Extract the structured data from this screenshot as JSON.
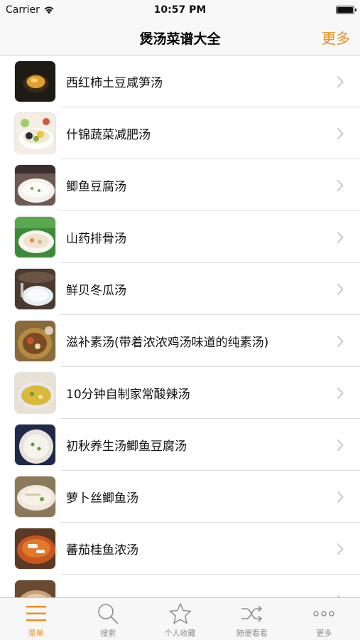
{
  "status_bar": {
    "carrier": "Carrier",
    "time": "10:57 PM"
  },
  "nav": {
    "title": "煲汤菜谱大全",
    "more": "更多"
  },
  "recipes": [
    {
      "title": "西红柿土豆咸笋汤"
    },
    {
      "title": "什锦蔬菜减肥汤"
    },
    {
      "title": "鲫鱼豆腐汤"
    },
    {
      "title": "山药排骨汤"
    },
    {
      "title": "鲜贝冬瓜汤"
    },
    {
      "title": "滋补素汤(带着浓浓鸡汤味道的纯素汤)"
    },
    {
      "title": "10分钟自制家常酸辣汤"
    },
    {
      "title": "初秋养生汤鲫鱼豆腐汤"
    },
    {
      "title": "萝卜丝鲫鱼汤"
    },
    {
      "title": "蕃茄桂鱼浓汤"
    },
    {
      "title": ""
    }
  ],
  "tabs": [
    {
      "label": "菜单",
      "icon": "menu-icon"
    },
    {
      "label": "搜索",
      "icon": "search-icon"
    },
    {
      "label": "个人收藏",
      "icon": "star-icon"
    },
    {
      "label": "随便看看",
      "icon": "shuffle-icon"
    },
    {
      "label": "更多",
      "icon": "more-dots-icon"
    }
  ],
  "colors": {
    "accent": "#f08c16",
    "inactive": "#8e8e93"
  }
}
